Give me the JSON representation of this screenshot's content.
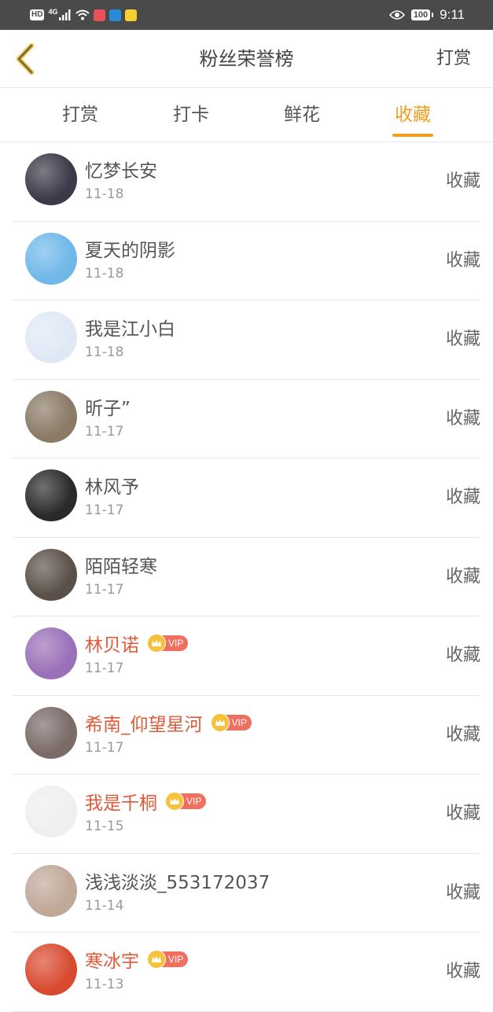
{
  "status_bar": {
    "hd": "HD",
    "network": "4G",
    "battery": "100",
    "time": "9:11",
    "icons": [
      "signal-icon",
      "wifi-icon",
      "notification-app-icon",
      "message-app-icon",
      "game-app-icon",
      "eye-icon"
    ]
  },
  "header": {
    "title": "粉丝荣誉榜",
    "action": "打赏",
    "back_icon": "chevron-left-icon",
    "accent_color": "#f0a020"
  },
  "tabs": [
    {
      "label": "打赏",
      "active": false
    },
    {
      "label": "打卡",
      "active": false
    },
    {
      "label": "鲜花",
      "active": false
    },
    {
      "label": "收藏",
      "active": true
    }
  ],
  "list": {
    "action_label": "收藏",
    "vip_label": "VIP",
    "items": [
      {
        "name": "忆梦长安",
        "date": "11-18",
        "vip": false,
        "avatar_color": "#3a3a48"
      },
      {
        "name": "夏天的阴影",
        "date": "11-18",
        "vip": false,
        "avatar_color": "#6fb8e8"
      },
      {
        "name": "我是江小白",
        "date": "11-18",
        "vip": false,
        "avatar_color": "#dfe9f5"
      },
      {
        "name": "昕子”",
        "date": "11-17",
        "vip": false,
        "avatar_color": "#8a7a66"
      },
      {
        "name": "林风予",
        "date": "11-17",
        "vip": false,
        "avatar_color": "#2a2a2a"
      },
      {
        "name": "陌陌轻寒",
        "date": "11-17",
        "vip": false,
        "avatar_color": "#5a5048"
      },
      {
        "name": "林贝诺",
        "date": "11-17",
        "vip": true,
        "avatar_color": "#9a70b8"
      },
      {
        "name": "希南_仰望星河",
        "date": "11-17",
        "vip": true,
        "avatar_color": "#7a6a68"
      },
      {
        "name": "我是千桐",
        "date": "11-15",
        "vip": true,
        "avatar_color": "#f0eef0"
      },
      {
        "name": "浅浅淡淡_553172037",
        "date": "11-14",
        "vip": false,
        "avatar_color": "#c0a898"
      },
      {
        "name": "寒冰宇",
        "date": "11-13",
        "vip": true,
        "avatar_color": "#d84a30"
      }
    ]
  }
}
